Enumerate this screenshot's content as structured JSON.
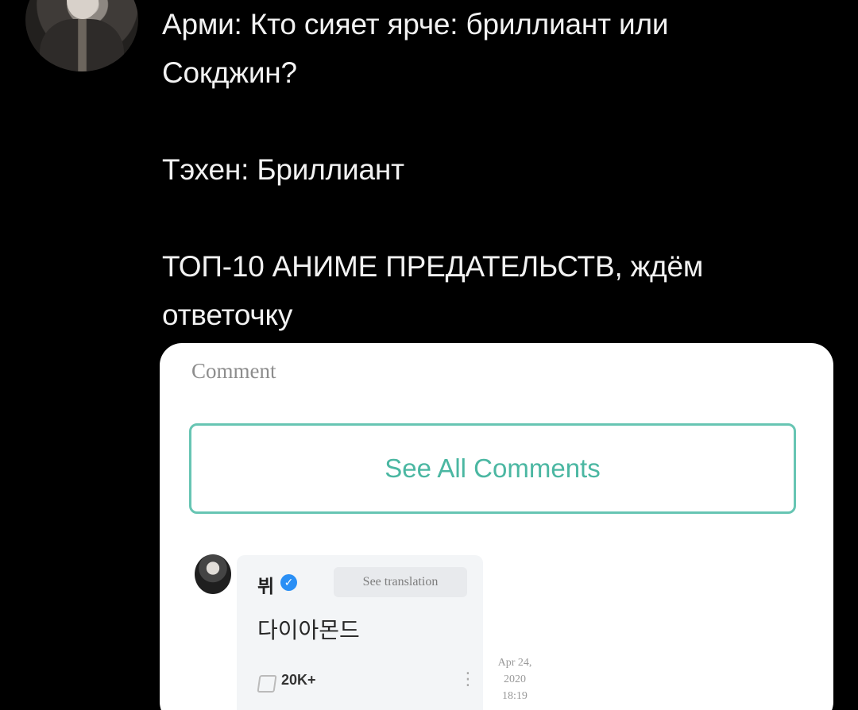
{
  "post": {
    "line1": "Арми: Кто сияет ярче: бриллиант или",
    "line2": "Сокджин?",
    "line3": "Тэхен: Бриллиант",
    "line4": "ТОП-10 АНИМЕ ПРЕДАТЕЛЬСТВ, ждём",
    "line5": "ответочку"
  },
  "comment_card": {
    "title": "Comment",
    "see_all_label": "See All Comments",
    "user_name": "뷔",
    "verified_icon": "check-badge-icon",
    "translate_label": "See translation",
    "body": "다이아몬드",
    "likes": "20K+",
    "date_line1": "Apr 24,",
    "date_line2": "2020",
    "date_line3": "18:19"
  },
  "colors": {
    "background": "#000000",
    "card_background": "#ffffff",
    "accent": "#4bb7a2",
    "verified": "#2a8ff5"
  }
}
